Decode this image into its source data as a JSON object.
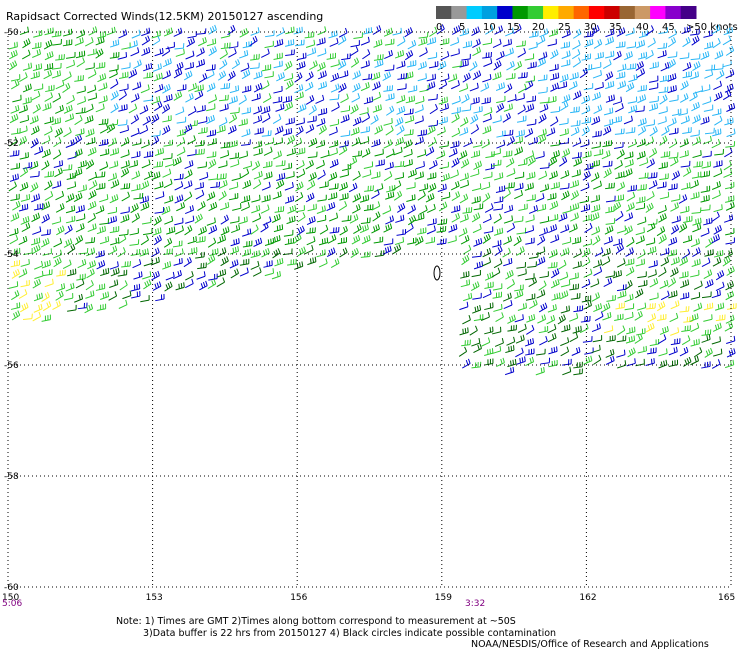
{
  "title": "Rapidsact Corrected Winds(12.5KM) 20150127 ascending",
  "legend": {
    "labels": [
      "0",
      "5",
      "10",
      "15",
      "20",
      "25",
      "30",
      "35",
      "40",
      "45",
      ">50 knots"
    ],
    "colors": [
      "#555555",
      "#999999",
      "#00ccff",
      "#00a0e0",
      "#0000cc",
      "#009900",
      "#33cc33",
      "#ffee00",
      "#ffaa00",
      "#ff6600",
      "#ff0000",
      "#cc0000",
      "#996633",
      "#cc9966",
      "#ff00ff",
      "#8800cc",
      "#440088"
    ]
  },
  "map": {
    "lat_labels": [
      "-50",
      "-52",
      "-54",
      "-56",
      "-58",
      "-60"
    ],
    "lon_labels": [
      "150",
      "153",
      "156",
      "159",
      "162",
      "165"
    ],
    "time_labels": [
      "5:06",
      "3:32"
    ],
    "lon_range": [
      150,
      165
    ],
    "lat_range": [
      -60,
      -50
    ]
  },
  "notes": {
    "line1": "Note: 1) Times are GMT 2)Times along bottom correspond to measurement at ~50S",
    "line2": "3)Data buffer is 22 hrs from 20150127 4) Black circles indicate possible contamination",
    "credit": "NOAA/NESDIS/Office of Research and Applications"
  }
}
